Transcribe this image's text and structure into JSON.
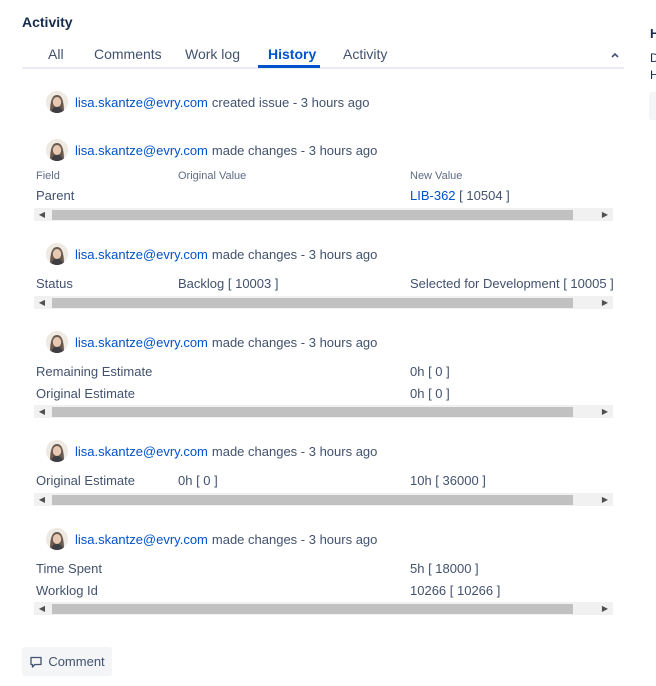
{
  "activity": {
    "title": "Activity",
    "tabs": [
      {
        "label": "All",
        "active": false
      },
      {
        "label": "Comments",
        "active": false
      },
      {
        "label": "Work log",
        "active": false
      },
      {
        "label": "History",
        "active": true
      },
      {
        "label": "Activity",
        "active": false
      }
    ]
  },
  "columns": {
    "field": "Field",
    "original": "Original Value",
    "new": "New Value"
  },
  "entries": [
    {
      "user": "lisa.skantze@evry.com",
      "action": "created issue - 3 hours ago"
    },
    {
      "user": "lisa.skantze@evry.com",
      "action": "made changes - 3 hours ago",
      "rows": [
        {
          "field": "Parent",
          "original": "",
          "new_link": "LIB-362",
          "new": "[ 10504 ]"
        }
      ]
    },
    {
      "user": "lisa.skantze@evry.com",
      "action": "made changes - 3 hours ago",
      "rows": [
        {
          "field": "Status",
          "original": "Backlog [ 10003 ]",
          "new": "Selected for Development [ 10005 ]"
        }
      ]
    },
    {
      "user": "lisa.skantze@evry.com",
      "action": "made changes - 3 hours ago",
      "rows": [
        {
          "field": "Remaining Estimate",
          "original": "",
          "new": "0h [ 0 ]"
        },
        {
          "field": "Original Estimate",
          "original": "",
          "new": "0h [ 0 ]"
        }
      ]
    },
    {
      "user": "lisa.skantze@evry.com",
      "action": "made changes - 3 hours ago",
      "rows": [
        {
          "field": "Original Estimate",
          "original": "0h [ 0 ]",
          "new": "10h [ 36000 ]"
        }
      ]
    },
    {
      "user": "lisa.skantze@evry.com",
      "action": "made changes - 3 hours ago",
      "rows": [
        {
          "field": "Time Spent",
          "original": "",
          "new": "5h [ 18000 ]"
        },
        {
          "field": "Worklog Id",
          "original": "",
          "new": "10266 [ 10266 ]"
        }
      ]
    }
  ],
  "comment_button": {
    "label": "Comment"
  },
  "right_panel": {
    "line1": "H",
    "line2": "D",
    "line3": "H"
  },
  "icons": {
    "avatar": "user-avatar",
    "comment": "comment-icon",
    "collapse": "chevron-up-icon"
  }
}
